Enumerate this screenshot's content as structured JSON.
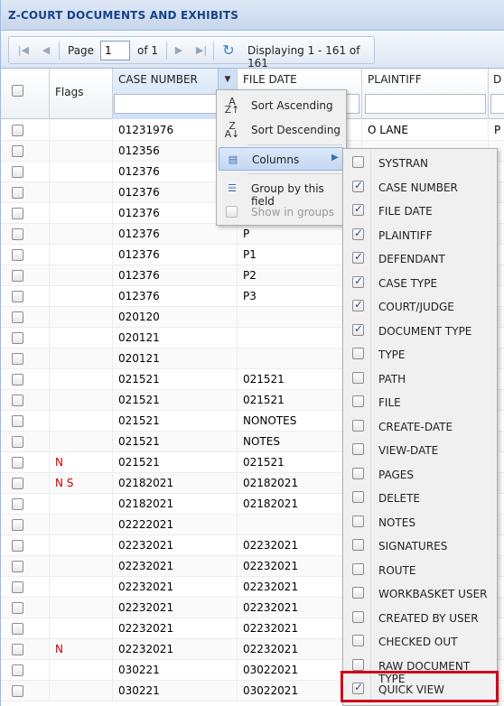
{
  "panel": {
    "title": "Z-COURT DOCUMENTS AND EXHIBITS"
  },
  "pager": {
    "page_label": "Page",
    "page_value": "1",
    "of_label": "of 1",
    "displaying": "Displaying 1 - 161 of 161",
    "icons": [
      "first-page-icon",
      "prev-page-icon",
      "next-page-icon",
      "last-page-icon",
      "refresh-icon"
    ]
  },
  "columns": {
    "flags": "Flags",
    "case_number": "CASE NUMBER",
    "file_date": "FILE DATE",
    "plaintiff": "PLAINTIFF",
    "next": "D"
  },
  "rows": [
    {
      "flags": "",
      "case": "01231976",
      "date": "",
      "plaintiff": "O LANE",
      "d": "P"
    },
    {
      "flags": "",
      "case": "012356",
      "date": "",
      "plaintiff": "",
      "d": ""
    },
    {
      "flags": "",
      "case": "012376",
      "date": "",
      "plaintiff": "",
      "d": ""
    },
    {
      "flags": "",
      "case": "012376",
      "date": "",
      "plaintiff": "",
      "d": ""
    },
    {
      "flags": "",
      "case": "012376",
      "date": "",
      "plaintiff": "",
      "d": ""
    },
    {
      "flags": "",
      "case": "012376",
      "date": "P",
      "plaintiff": "",
      "d": ""
    },
    {
      "flags": "",
      "case": "012376",
      "date": "P1",
      "plaintiff": "",
      "d": ""
    },
    {
      "flags": "",
      "case": "012376",
      "date": "P2",
      "plaintiff": "",
      "d": ""
    },
    {
      "flags": "",
      "case": "012376",
      "date": "P3",
      "plaintiff": "",
      "d": ""
    },
    {
      "flags": "",
      "case": "020120",
      "date": "",
      "plaintiff": "",
      "d": ""
    },
    {
      "flags": "",
      "case": "020121",
      "date": "",
      "plaintiff": "",
      "d": ""
    },
    {
      "flags": "",
      "case": "020121",
      "date": "",
      "plaintiff": "",
      "d": ""
    },
    {
      "flags": "",
      "case": "021521",
      "date": "021521",
      "plaintiff": "",
      "d": ""
    },
    {
      "flags": "",
      "case": "021521",
      "date": "021521",
      "plaintiff": "",
      "d": ""
    },
    {
      "flags": "",
      "case": "021521",
      "date": "NONOTES",
      "plaintiff": "",
      "d": ""
    },
    {
      "flags": "",
      "case": "021521",
      "date": "NOTES",
      "plaintiff": "",
      "d": ""
    },
    {
      "flags": "N",
      "case": "021521",
      "date": "021521",
      "plaintiff": "",
      "d": ""
    },
    {
      "flags": "N S",
      "case": "02182021",
      "date": "02182021",
      "plaintiff": "",
      "d": ""
    },
    {
      "flags": "",
      "case": "02182021",
      "date": "02182021",
      "plaintiff": "",
      "d": ""
    },
    {
      "flags": "",
      "case": "02222021",
      "date": "",
      "plaintiff": "",
      "d": ""
    },
    {
      "flags": "",
      "case": "02232021",
      "date": "02232021",
      "plaintiff": "",
      "d": ""
    },
    {
      "flags": "",
      "case": "02232021",
      "date": "02232021",
      "plaintiff": "",
      "d": ""
    },
    {
      "flags": "",
      "case": "02232021",
      "date": "02232021",
      "plaintiff": "",
      "d": ""
    },
    {
      "flags": "",
      "case": "02232021",
      "date": "02232021",
      "plaintiff": "",
      "d": ""
    },
    {
      "flags": "",
      "case": "02232021",
      "date": "02232021",
      "plaintiff": "",
      "d": ""
    },
    {
      "flags": "N",
      "case": "02232021",
      "date": "02232021",
      "plaintiff": "",
      "d": ""
    },
    {
      "flags": "",
      "case": "030221",
      "date": "03022021",
      "plaintiff": "",
      "d": ""
    },
    {
      "flags": "",
      "case": "030221",
      "date": "03022021",
      "plaintiff": "",
      "d": ""
    }
  ],
  "column_menu": {
    "items": [
      {
        "label": "Sort Ascending",
        "icon": "sort-ascending-icon"
      },
      {
        "label": "Sort Descending",
        "icon": "sort-descending-icon"
      },
      {
        "label": "Columns",
        "icon": "columns-icon"
      },
      {
        "label": "Group by this field",
        "icon": "group-icon"
      },
      {
        "label": "Show in groups",
        "icon": "checkbox-icon"
      }
    ]
  },
  "columns_submenu": {
    "items": [
      {
        "label": "SYSTRAN",
        "checked": false
      },
      {
        "label": "CASE NUMBER",
        "checked": true
      },
      {
        "label": "FILE DATE",
        "checked": true
      },
      {
        "label": "PLAINTIFF",
        "checked": true
      },
      {
        "label": "DEFENDANT",
        "checked": true
      },
      {
        "label": "CASE TYPE",
        "checked": true
      },
      {
        "label": "COURT/JUDGE",
        "checked": true
      },
      {
        "label": "DOCUMENT TYPE",
        "checked": true
      },
      {
        "label": "TYPE",
        "checked": false
      },
      {
        "label": "PATH",
        "checked": false
      },
      {
        "label": "FILE",
        "checked": false
      },
      {
        "label": "CREATE-DATE",
        "checked": false
      },
      {
        "label": "VIEW-DATE",
        "checked": false
      },
      {
        "label": "PAGES",
        "checked": false
      },
      {
        "label": "DELETE",
        "checked": false
      },
      {
        "label": "NOTES",
        "checked": false
      },
      {
        "label": "SIGNATURES",
        "checked": false
      },
      {
        "label": "ROUTE",
        "checked": false
      },
      {
        "label": "WORKBASKET USER",
        "checked": false
      },
      {
        "label": "CREATED BY USER",
        "checked": false
      },
      {
        "label": "CHECKED OUT",
        "checked": false
      },
      {
        "label": "RAW DOCUMENT TYPE",
        "checked": false
      },
      {
        "label": "QUICK VIEW",
        "checked": true
      }
    ]
  },
  "colors": {
    "highlight": "#d0021b",
    "flag": "#cc0000",
    "header_text": "#15428b"
  }
}
